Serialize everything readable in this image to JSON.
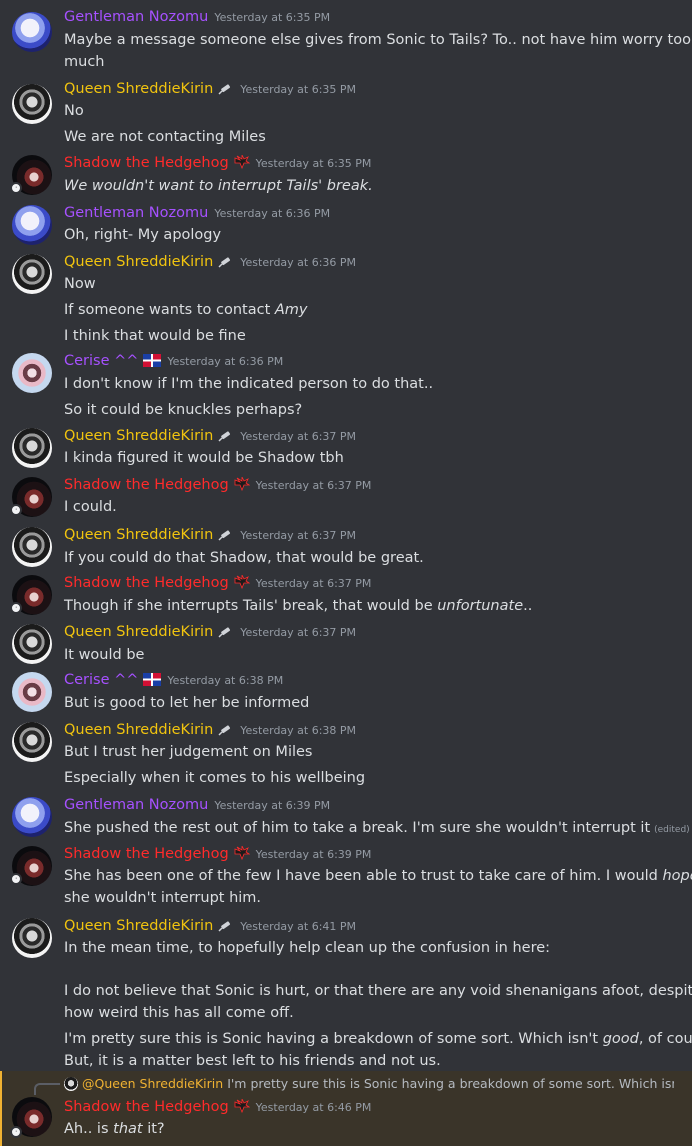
{
  "messages": [
    {
      "author": "Gentleman Nozomu",
      "time": "Yesterday at 6:35 PM",
      "lines": [
        "Maybe a message someone else gives from Sonic to Tails? To.. not have him worry too",
        "much"
      ]
    },
    {
      "author": "Queen ShreddieKirin",
      "time": "Yesterday at 6:35 PM",
      "lines": [
        "No",
        "We are not contacting Miles"
      ]
    },
    {
      "author": "Shadow the Hedgehog",
      "time": "Yesterday at 6:35 PM",
      "lines": [
        "We wouldn't want to interrupt Tails' break."
      ]
    },
    {
      "author": "Gentleman Nozomu",
      "time": "Yesterday at 6:36 PM",
      "lines": [
        "Oh, right- My apology"
      ]
    },
    {
      "author": "Queen ShreddieKirin",
      "time": "Yesterday at 6:36 PM",
      "lines": [
        "Now",
        "If someone wants to contact ",
        "Amy",
        "I think that would be fine"
      ]
    },
    {
      "author": "Cerise ^^",
      "time": "Yesterday at 6:36 PM",
      "lines": [
        "I don't know if I'm the indicated person to do that..",
        "So it could be knuckles perhaps?"
      ]
    },
    {
      "author": "Queen ShreddieKirin",
      "time": "Yesterday at 6:37 PM",
      "lines": [
        "I kinda figured it would be Shadow tbh"
      ]
    },
    {
      "author": "Shadow the Hedgehog",
      "time": "Yesterday at 6:37 PM",
      "lines": [
        "I could."
      ]
    },
    {
      "author": "Queen ShreddieKirin",
      "time": "Yesterday at 6:37 PM",
      "lines": [
        "If you could do that Shadow, that would be great."
      ]
    },
    {
      "author": "Shadow the Hedgehog",
      "time": "Yesterday at 6:37 PM",
      "lines": [
        "Though if she interrupts Tails' break, that would be ",
        "unfortunate",
        ".."
      ]
    },
    {
      "author": "Queen ShreddieKirin",
      "time": "Yesterday at 6:37 PM",
      "lines": [
        "It would be"
      ]
    },
    {
      "author": "Cerise ^^",
      "time": "Yesterday at 6:38 PM",
      "lines": [
        "But is good to let her be informed"
      ]
    },
    {
      "author": "Queen ShreddieKirin",
      "time": "Yesterday at 6:38 PM",
      "lines": [
        "But I trust her judgement on Miles",
        "Especially when it comes to his wellbeing"
      ]
    },
    {
      "author": "Gentleman Nozomu",
      "time": "Yesterday at 6:39 PM",
      "lines": [
        "She pushed the rest out of him to take a break. I'm sure she wouldn't interrupt it"
      ],
      "edited": "(edited)"
    },
    {
      "author": "Shadow the Hedgehog",
      "time": "Yesterday at 6:39 PM",
      "lines": [
        "She has been one of the few I have been able to trust to take care of him. I would ",
        "hope",
        "she wouldn't interrupt him."
      ]
    },
    {
      "author": "Queen ShreddieKirin",
      "time": "Yesterday at 6:41 PM",
      "lines": [
        "In the mean time, to hopefully help clean up the confusion in here:",
        "I do not believe that Sonic is hurt, or that there are any void shenanigans afoot, despite",
        "how weird this has all come off.",
        "I'm pretty sure this is Sonic having a breakdown of some sort. Which isn't ",
        "good",
        ", of course.",
        "But, it is a matter best left to his friends and not us."
      ]
    },
    {
      "author": "Shadow the Hedgehog",
      "time": "Yesterday at 6:46 PM",
      "lines": [
        "Ah.. is ",
        "that",
        " it?"
      ]
    }
  ],
  "reply": {
    "mention": "@Queen ShreddieKirin",
    "preview": "I'm pretty sure this is Sonic having a breakdown of some sort. Which isn't ..."
  }
}
